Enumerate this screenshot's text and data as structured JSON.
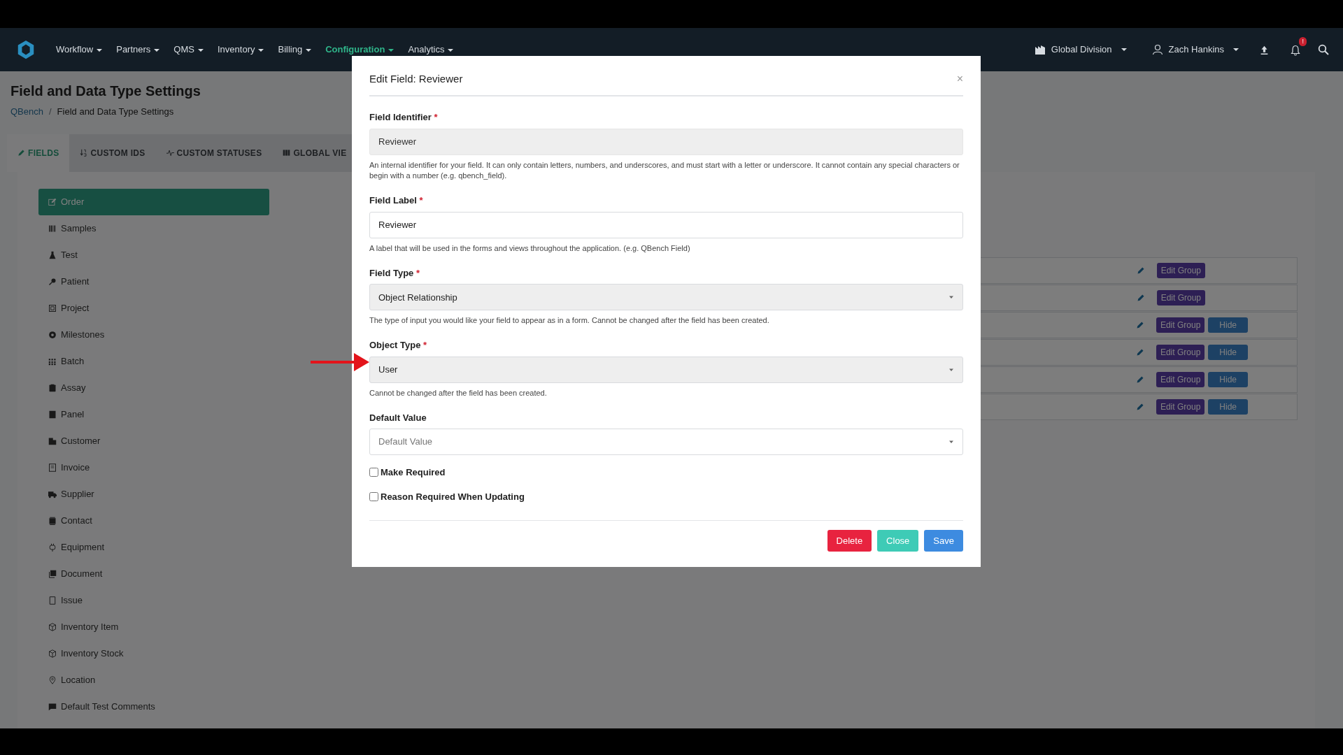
{
  "navbar": {
    "menus": [
      {
        "label": "Workflow",
        "selected": false
      },
      {
        "label": "Partners",
        "selected": false
      },
      {
        "label": "QMS",
        "selected": false
      },
      {
        "label": "Inventory",
        "selected": false
      },
      {
        "label": "Billing",
        "selected": false
      },
      {
        "label": "Configuration",
        "selected": true
      },
      {
        "label": "Analytics",
        "selected": false
      }
    ],
    "division": "Global Division",
    "user": "Zach Hankins",
    "notification_badge": "!"
  },
  "page": {
    "title": "Field and Data Type Settings",
    "breadcrumb": [
      "QBench",
      "Field and Data Type Settings"
    ],
    "breadcrumb_separator": "/"
  },
  "tabs": [
    {
      "label": "FIELDS",
      "selected": true
    },
    {
      "label": "CUSTOM IDS",
      "selected": false
    },
    {
      "label": "CUSTOM STATUSES",
      "selected": false
    },
    {
      "label": "GLOBAL VIE",
      "selected": false
    }
  ],
  "sidebar": {
    "items": [
      {
        "label": "Order",
        "selected": true
      },
      {
        "label": "Samples",
        "selected": false
      },
      {
        "label": "Test",
        "selected": false
      },
      {
        "label": "Patient",
        "selected": false
      },
      {
        "label": "Project",
        "selected": false
      },
      {
        "label": "Milestones",
        "selected": false
      },
      {
        "label": "Batch",
        "selected": false
      },
      {
        "label": "Assay",
        "selected": false
      },
      {
        "label": "Panel",
        "selected": false
      },
      {
        "label": "Customer",
        "selected": false
      },
      {
        "label": "Invoice",
        "selected": false
      },
      {
        "label": "Supplier",
        "selected": false
      },
      {
        "label": "Contact",
        "selected": false
      },
      {
        "label": "Equipment",
        "selected": false
      },
      {
        "label": "Document",
        "selected": false
      },
      {
        "label": "Issue",
        "selected": false
      },
      {
        "label": "Inventory Item",
        "selected": false
      },
      {
        "label": "Inventory Stock",
        "selected": false
      },
      {
        "label": "Location",
        "selected": false
      },
      {
        "label": "Default Test Comments",
        "selected": false
      }
    ]
  },
  "groups": [
    {
      "buttons": [
        {
          "label": "Edit Group",
          "kind": "edit"
        }
      ]
    },
    {
      "buttons": [
        {
          "label": "Edit Group",
          "kind": "edit"
        }
      ]
    },
    {
      "buttons": [
        {
          "label": "Edit Group",
          "kind": "edit"
        },
        {
          "label": "Hide",
          "kind": "hide"
        }
      ]
    },
    {
      "buttons": [
        {
          "label": "Edit Group",
          "kind": "edit"
        },
        {
          "label": "Hide",
          "kind": "hide"
        }
      ]
    },
    {
      "buttons": [
        {
          "label": "Edit Group",
          "kind": "edit"
        },
        {
          "label": "Hide",
          "kind": "hide"
        }
      ]
    },
    {
      "buttons": [
        {
          "label": "Edit Group",
          "kind": "edit"
        },
        {
          "label": "Hide",
          "kind": "hide"
        }
      ]
    }
  ],
  "modal": {
    "title": "Edit Field: Reviewer",
    "close_label": "×",
    "required_mark": "*",
    "fields": [
      {
        "kind": "text",
        "label": "Field Identifier",
        "required": true,
        "disabled": true,
        "value": "Reviewer",
        "help": "An internal identifier for your field. It can only contain letters, numbers, and underscores, and must start with a letter or underscore. It cannot contain any special characters or begin with a number (e.g. qbench_field)."
      },
      {
        "kind": "text",
        "label": "Field Label",
        "required": true,
        "disabled": false,
        "value": "Reviewer",
        "help": "A label that will be used in the forms and views throughout the application. (e.g. QBench Field)"
      },
      {
        "kind": "select",
        "label": "Field Type",
        "required": true,
        "disabled": true,
        "value": "Object Relationship",
        "help": "The type of input you would like your field to appear as in a form. Cannot be changed after the field has been created."
      },
      {
        "kind": "select",
        "label": "Object Type",
        "required": true,
        "disabled": true,
        "value": "User",
        "help": "Cannot be changed after the field has been created."
      },
      {
        "kind": "select",
        "label": "Default Value",
        "required": false,
        "disabled": false,
        "placeholder": "Default Value"
      }
    ],
    "checkboxes": [
      {
        "label": "Make Required",
        "checked": false
      },
      {
        "label": "Reason Required When Updating",
        "checked": false
      }
    ],
    "buttons": [
      {
        "label": "Delete",
        "kind": "danger"
      },
      {
        "label": "Close",
        "kind": "close"
      },
      {
        "label": "Save",
        "kind": "primary"
      }
    ]
  }
}
